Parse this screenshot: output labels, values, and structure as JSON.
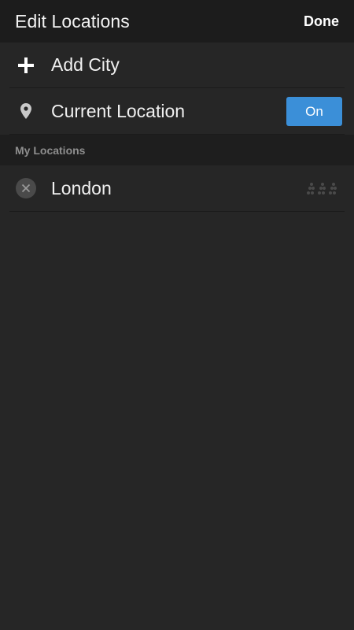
{
  "header": {
    "title": "Edit Locations",
    "done_label": "Done"
  },
  "add_city": {
    "icon": "plus-icon",
    "label": "Add City"
  },
  "current_location": {
    "icon": "location-pin-icon",
    "label": "Current Location",
    "toggle_label": "On",
    "toggle_state": true
  },
  "my_locations": {
    "section_title": "My Locations",
    "items": [
      {
        "name": "London",
        "remove_icon": "close-icon",
        "drag_icon": "drag-handle-icon"
      }
    ]
  },
  "colors": {
    "background": "#262626",
    "header_bg": "#1c1c1c",
    "section_bg": "#1e1e1e",
    "accent": "#3b8fd8",
    "section_text": "#8e8e8e"
  }
}
